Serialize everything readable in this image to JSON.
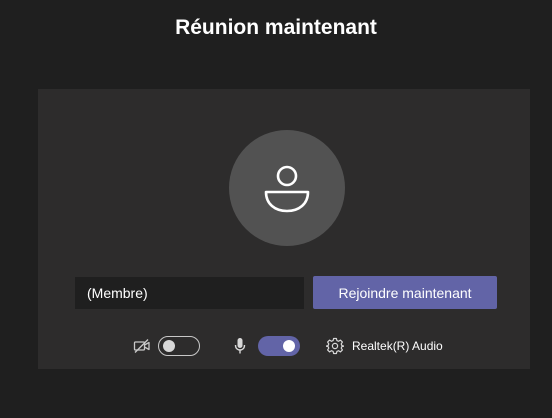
{
  "title": "Réunion maintenant",
  "name_input": {
    "value": "(Membre)"
  },
  "join_button": {
    "label": "Rejoindre maintenant"
  },
  "controls": {
    "camera": {
      "enabled": false,
      "icon": "camera-off-icon"
    },
    "microphone": {
      "enabled": true,
      "icon": "microphone-icon"
    },
    "device_settings": {
      "icon": "gear-icon",
      "label": "Realtek(R) Audio"
    }
  },
  "colors": {
    "background": "#1f1f1f",
    "panel": "#2d2c2c",
    "avatar": "#525252",
    "accent": "#6264a7",
    "text": "#ffffff"
  }
}
